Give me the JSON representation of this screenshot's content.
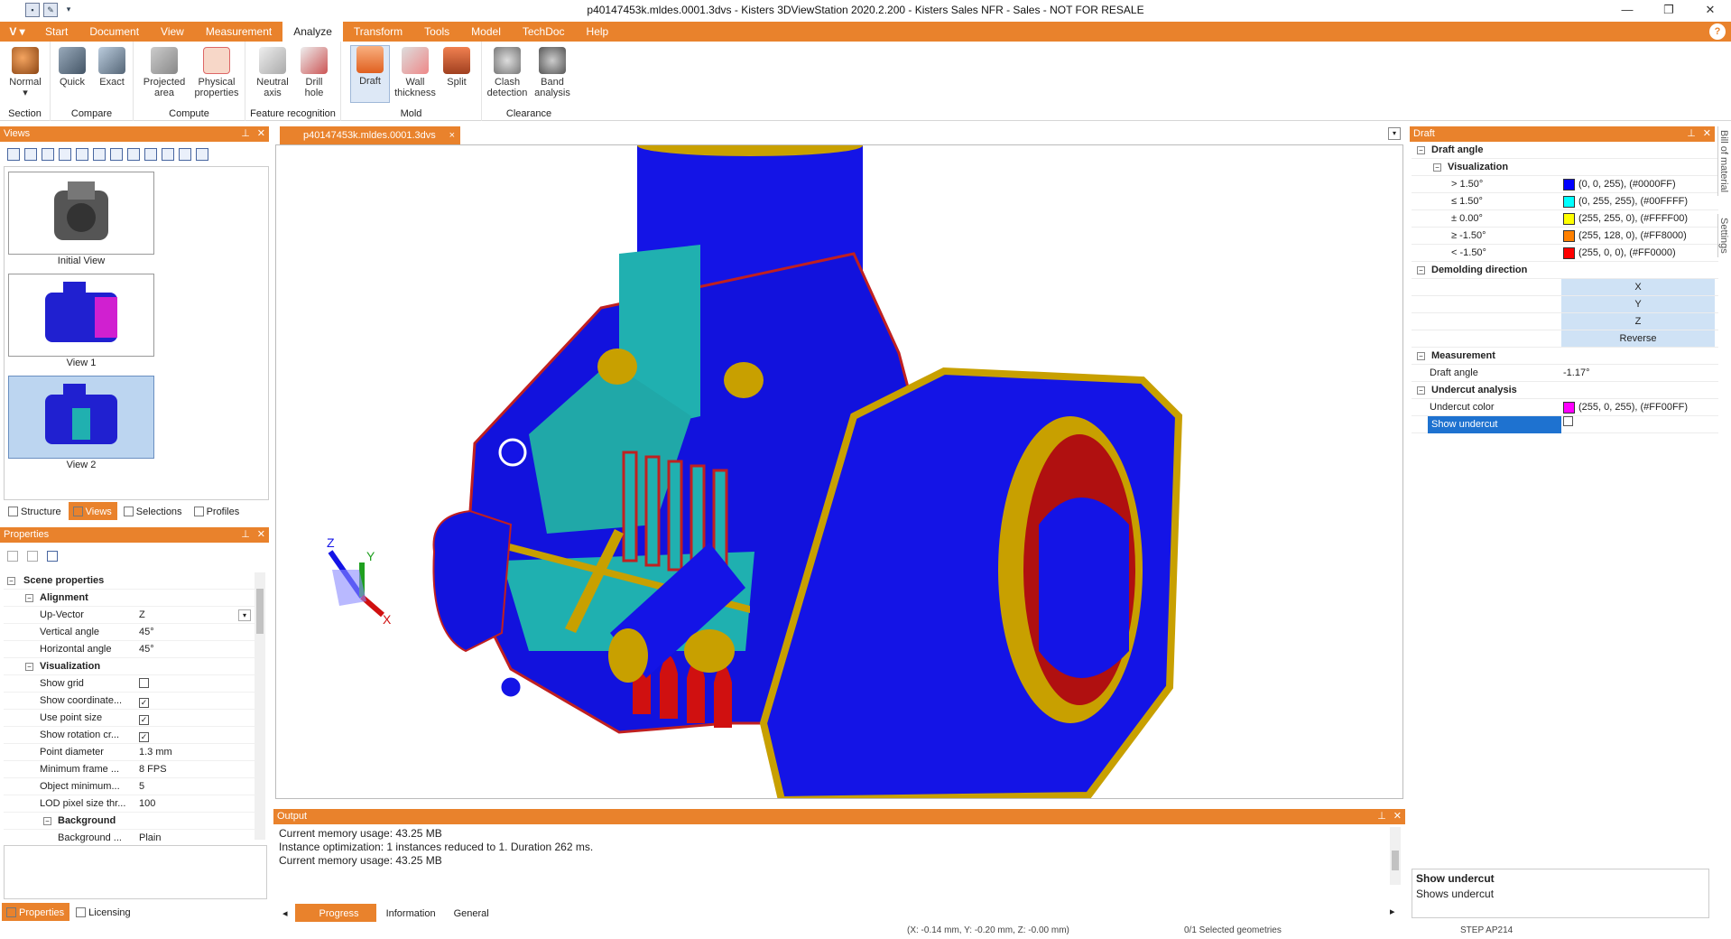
{
  "window": {
    "title": "p40147453k.mldes.0001.3dvs - Kisters 3DViewStation 2020.2.200 - Kisters Sales NFR - Sales - NOT FOR RESALE",
    "controls": [
      "—",
      "❐",
      "✕"
    ]
  },
  "menu": {
    "app_button": "V",
    "tabs": [
      "Start",
      "Document",
      "View",
      "Measurement",
      "Analyze",
      "Transform",
      "Tools",
      "Model",
      "TechDoc",
      "Help"
    ],
    "active": "Analyze",
    "help": "?"
  },
  "ribbon": {
    "section": {
      "label": "Section",
      "buttons": [
        "Normal"
      ]
    },
    "compare": {
      "label": "Compare",
      "buttons": [
        "Quick",
        "Exact"
      ]
    },
    "compute": {
      "label": "Compute",
      "buttons": [
        "Projected area",
        "Physical properties"
      ]
    },
    "feature": {
      "label": "Feature recognition",
      "buttons": [
        "Neutral axis",
        "Drill hole"
      ]
    },
    "mold": {
      "label": "Mold",
      "buttons": [
        "Draft",
        "Wall thickness",
        "Split"
      ]
    },
    "clearance": {
      "label": "Clearance",
      "buttons": [
        "Clash detection",
        "Band analysis"
      ]
    },
    "ribbon_labels": {
      "normal": "Normal",
      "quick": "Quick",
      "exact": "Exact",
      "projected_1": "Projected",
      "projected_2": "area",
      "physical_1": "Physical",
      "physical_2": "properties",
      "neutral_1": "Neutral",
      "neutral_2": "axis",
      "drill_1": "Drill",
      "drill_2": "hole",
      "draft": "Draft",
      "wall_1": "Wall",
      "wall_2": "thickness",
      "split": "Split",
      "clash_1": "Clash",
      "clash_2": "detection",
      "band_1": "Band",
      "band_2": "analysis"
    }
  },
  "views_panel": {
    "title": "Views",
    "views": [
      "Initial View",
      "View 1",
      "View 2"
    ],
    "tabs": [
      "Structure",
      "Views",
      "Selections",
      "Profiles"
    ],
    "active_tab": "Views"
  },
  "properties_panel": {
    "title": "Properties",
    "root": "Scene properties",
    "alignment": "Alignment",
    "rows_alignment": [
      {
        "name": "Up-Vector",
        "value": "Z"
      },
      {
        "name": "Vertical angle",
        "value": "45°"
      },
      {
        "name": "Horizontal angle",
        "value": "45°"
      }
    ],
    "visualization": "Visualization",
    "rows_visual": [
      {
        "name": "Show grid",
        "value": ""
      },
      {
        "name": "Show coordinate...",
        "value": "✓"
      },
      {
        "name": "Use point size",
        "value": "✓"
      },
      {
        "name": "Show rotation cr...",
        "value": "✓"
      },
      {
        "name": "Point diameter",
        "value": "1.3 mm"
      },
      {
        "name": "Minimum frame ...",
        "value": "8 FPS"
      },
      {
        "name": "Object minimum...",
        "value": "5"
      },
      {
        "name": "LOD pixel size thr...",
        "value": "100"
      }
    ],
    "background": "Background",
    "background_row": {
      "name": "Background ...",
      "value": "Plain"
    },
    "tabs": [
      "Properties",
      "Licensing"
    ],
    "active_tab": "Properties"
  },
  "document": {
    "tab": "p40147453k.mldes.0001.3dvs",
    "close": "×"
  },
  "output": {
    "title": "Output",
    "lines": [
      "Current memory usage: 43.25 MB",
      "Instance optimization: 1 instances reduced to 1. Duration 262 ms.",
      "Current memory usage: 43.25 MB"
    ],
    "tabs": [
      "Progress",
      "Information",
      "General"
    ],
    "active_tab": "Progress"
  },
  "draft_panel": {
    "title": "Draft",
    "draft_angle": "Draft angle",
    "visualization": "Visualization",
    "levels": [
      {
        "label": "> 1.50°",
        "value": "(0, 0, 255), (#0000FF)",
        "color": "#0000FF"
      },
      {
        "label": "≤ 1.50°",
        "value": "(0, 255, 255), (#00FFFF)",
        "color": "#00FFFF"
      },
      {
        "label": "± 0.00°",
        "value": "(255, 255, 0), (#FFFF00)",
        "color": "#FFFF00"
      },
      {
        "label": "≥ -1.50°",
        "value": "(255, 128, 0), (#FF8000)",
        "color": "#FF8000"
      },
      {
        "label": "< -1.50°",
        "value": "(255, 0, 0), (#FF0000)",
        "color": "#FF0000"
      }
    ],
    "demolding": "Demolding direction",
    "directions": [
      "X",
      "Y",
      "Z",
      "Reverse"
    ],
    "measurement": "Measurement",
    "measure_row": {
      "name": "Draft angle",
      "value": "-1.17°"
    },
    "undercut": "Undercut analysis",
    "undercut_color": {
      "name": "Undercut color",
      "value": "(255, 0, 255), (#FF00FF)",
      "color": "#FF00FF"
    },
    "show_undercut": {
      "name": "Show undercut",
      "value": ""
    },
    "desc_title": "Show undercut",
    "desc_text": "Shows undercut"
  },
  "side_tabs": [
    "Bill of material",
    "Settings"
  ],
  "status": {
    "coords": "(X: -0.14 mm, Y: -0.20 mm, Z: -0.00 mm)",
    "selected": "0/1 Selected geometries",
    "format": "STEP AP214"
  },
  "colors": {
    "accent": "#e9822c",
    "model_blue": "#1010e0",
    "model_cyan": "#20b0b0",
    "model_yellow": "#c8a000",
    "model_red": "#d01010"
  }
}
